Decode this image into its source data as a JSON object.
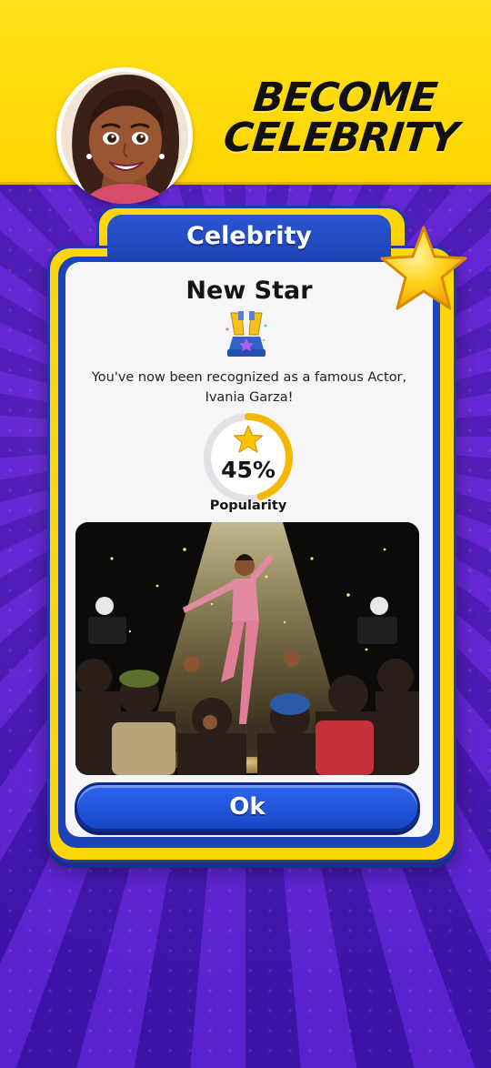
{
  "header": {
    "title_line1": "BECOME",
    "title_line2": "CELEBRITY"
  },
  "dialog": {
    "tab_title": "Celebrity",
    "title": "New Star",
    "message": "You've now been recognized as a famous Actor, Ivania Garza!",
    "popularity": {
      "value_text": "45%",
      "value": 45,
      "label": "Popularity"
    },
    "ok_label": "Ok"
  },
  "colors": {
    "header_yellow": "#ffd400",
    "bg_purple": "#4a1bbf",
    "card_blue": "#1d43b8",
    "button_blue": "#2458e0",
    "ring_gold": "#f5b800"
  },
  "icons": [
    "avatar",
    "star-badge-icon",
    "trophy-icon",
    "star-icon"
  ]
}
